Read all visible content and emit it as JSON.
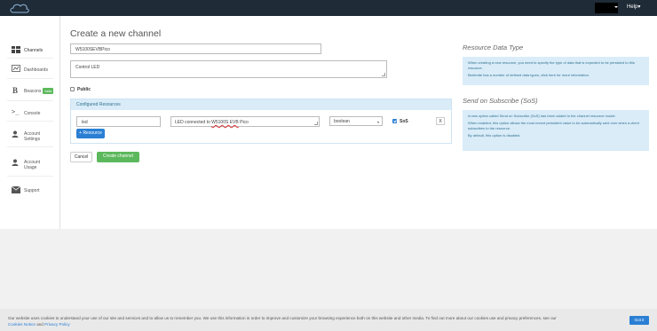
{
  "topbar": {
    "help_label": "Help"
  },
  "sidebar": {
    "items": [
      {
        "label": "Channels"
      },
      {
        "label": "Dashboards"
      },
      {
        "label": "Beacons",
        "badge": "beta"
      },
      {
        "label": "Console"
      },
      {
        "label": "Account Settings"
      },
      {
        "label": "Account Usage"
      },
      {
        "label": "Support"
      }
    ]
  },
  "main": {
    "title": "Create a new channel",
    "name_value": "W5100SEVBPico",
    "description_value": "Control LED",
    "public_label": "Public",
    "resources": {
      "header": "Configured Resources",
      "row": {
        "name_value": "led",
        "description_value": "LED connected to W5100S EVB Pico",
        "description_pre": "LED connected to ",
        "description_mid": "W5100S EVB",
        "description_post": " Pico",
        "type_value": "boolean",
        "sos_label": "SoS",
        "remove_label": "X"
      },
      "add_button": "+ Resource"
    },
    "cancel_label": "Cancel",
    "create_label": "Create channel"
  },
  "info": {
    "rdt_title": "Resource Data Type",
    "rdt_text1": "When creating a new resource, you need to specify the type of data that is expected to be persisted to this resource.",
    "rdt_text2": "Beebotte has a number of defined data types, click here for more information.",
    "sos_title": "Send on Subscribe (SoS)",
    "sos_text1": "A new option called Send on Subscribe (SoS) has been added to the channel resource model.",
    "sos_text2": "When enabled, this option allows the most recent persistent value to be automatically sent over when a client subscribes to the resource.",
    "sos_text3": "By default, this option is disabled."
  },
  "cookie": {
    "text": "Our website uses cookies to understand your use of our site and services and to allow us to remember you. We use this information in order to improve and customize your browsing experience both on this website and other media. To find out more about our cookies use and privacy preferences, see our",
    "link1": "Cookies Notice",
    "and": "and",
    "link2": "Privacy Policy",
    "button": "Got it"
  },
  "colors": {
    "accent": "#2a7fd4",
    "success": "#5cb85c",
    "topbar": "#1f2b36",
    "info_bg": "#d9ecf8"
  }
}
